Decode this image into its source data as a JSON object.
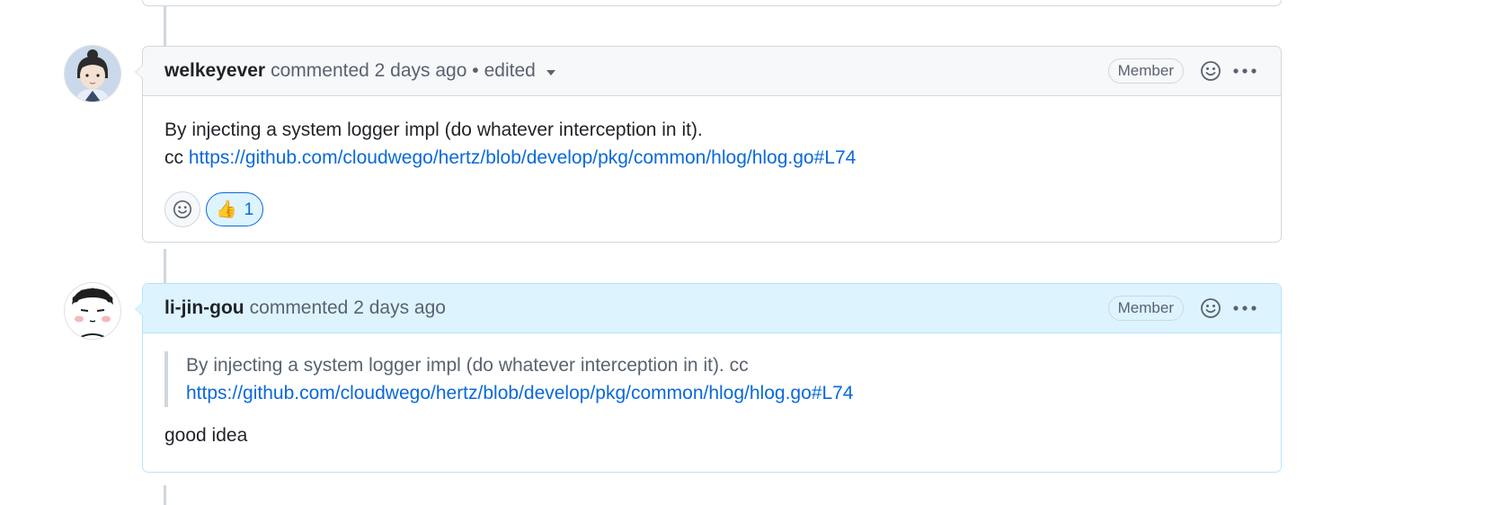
{
  "comments": [
    {
      "author": "welkeyever",
      "action": "commented",
      "timestamp": "2 days ago",
      "separator": "•",
      "edited_label": "edited",
      "role_badge": "Member",
      "body": {
        "line1": "By injecting a system logger impl (do whatever interception in it).",
        "line2_prefix": "cc",
        "link": "https://github.com/cloudwego/hertz/blob/develop/pkg/common/hlog/hlog.go#L74"
      },
      "reactions": [
        {
          "emoji": "👍",
          "count": "1"
        }
      ]
    },
    {
      "author": "li-jin-gou",
      "action": "commented",
      "timestamp": "2 days ago",
      "role_badge": "Member",
      "quote": {
        "text": "By injecting a system logger impl (do whatever interception in it). cc",
        "link": "https://github.com/cloudwego/hertz/blob/develop/pkg/common/hlog/hlog.go#L74"
      },
      "body_text": "good idea"
    }
  ],
  "colors": {
    "link": "#0969da",
    "highlight_header": "#ddf4ff",
    "border": "#d0d7de"
  },
  "icons": {
    "reaction": "smiley-icon",
    "more": "kebab-horizontal-icon"
  }
}
